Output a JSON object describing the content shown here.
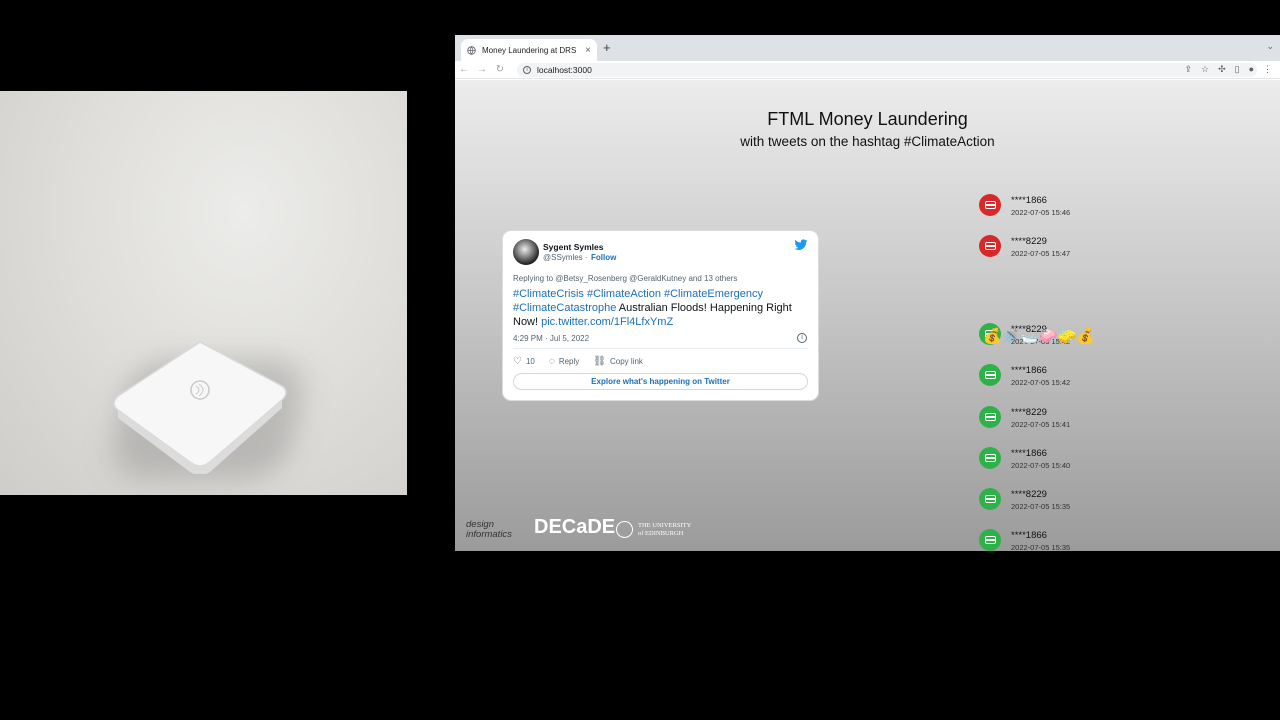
{
  "browser": {
    "tab_title": "Money Laundering at DRS",
    "tab_close": "×",
    "new_tab": "+",
    "tab_dropdown": "⌄",
    "url": "localhost:3000"
  },
  "page": {
    "title": "FTML Money Laundering",
    "subtitle": "with tweets on the hashtag #ClimateAction"
  },
  "tweet": {
    "name": "Sygent Symles",
    "handle": "@SSymles ·",
    "follow": "Follow",
    "replying_to": "Replying to @Betsy_Rosenberg @GeraldKutney and 13 others",
    "text_links_1": "#ClimateCrisis #ClimateAction #ClimateEmergency",
    "text_links_2": "#ClimateCatastrophe",
    "text_plain": " Australian Floods! Happening Right Now! ",
    "text_link_pic": "pic.twitter.com/1Fl4LfxYmZ",
    "timestamp": "4:29 PM · Jul 5, 2022",
    "like_count": "10",
    "reply_label": "Reply",
    "copy_link_label": "Copy link",
    "explore_label": "Explore what's happening on Twitter"
  },
  "transactions": [
    {
      "status": "declined",
      "card": "****1866",
      "time": "2022-07-05 15:46",
      "color": "#d9282a"
    },
    {
      "status": "declined",
      "card": "****8229",
      "time": "2022-07-05 15:47",
      "color": "#d9282a"
    },
    {
      "status": "approved",
      "card": "****8229",
      "time": "2022-07-05 15:42",
      "color": "#2fb14a"
    },
    {
      "status": "approved",
      "card": "****1866",
      "time": "2022-07-05 15:42",
      "color": "#2fb14a"
    },
    {
      "status": "approved",
      "card": "****8229",
      "time": "2022-07-05 15:41",
      "color": "#2fb14a"
    },
    {
      "status": "approved",
      "card": "****1866",
      "time": "2022-07-05 15:40",
      "color": "#2fb14a"
    },
    {
      "status": "approved",
      "card": "****8229",
      "time": "2022-07-05 15:35",
      "color": "#2fb14a"
    },
    {
      "status": "approved",
      "card": "****1866",
      "time": "2022-07-05 15:35",
      "color": "#2fb14a"
    }
  ],
  "laundering_emojis": "💰🚿🛁🧼🧽💰",
  "logos": {
    "design_line1": "design",
    "design_line2": "informatics",
    "decade": "DECaDE",
    "uoe_line1": "THE UNIVERSITY",
    "uoe_line2": "of EDINBURGH"
  },
  "icons": {
    "tab_favicon": "globe-icon",
    "back": "back-arrow-icon",
    "forward": "forward-arrow-icon",
    "reload": "reload-icon",
    "share": "share-icon",
    "bookmark": "star-icon",
    "extensions": "puzzle-icon",
    "sidepanel": "sidepanel-icon",
    "profile": "profile-icon",
    "menu": "kebab-menu-icon",
    "card": "credit-card-icon",
    "twitter": "twitter-bird-icon"
  }
}
